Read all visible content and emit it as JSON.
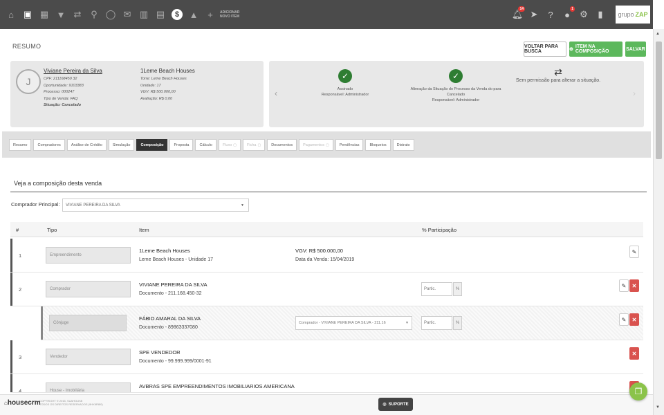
{
  "topbar": {
    "icons": [
      "home-icon",
      "calendar-icon",
      "grid-icon",
      "filter-icon",
      "handshake-icon",
      "map-pin-icon",
      "chat-icon",
      "mail-icon",
      "buildings-icon",
      "calculator-icon",
      "dollar-icon",
      "graduation-cap-icon",
      "plus-icon"
    ],
    "add_item_label": "Adicionar novo item",
    "notifications_badge": "14",
    "alerts_badge": "1",
    "brand_logo": "grupo",
    "brand_logo_accent": "ZAP"
  },
  "header": {
    "title": "RESUMO",
    "back_label": "VOLTAR PARA BUSCA",
    "add_composition_label": "ITEM NA COMPOSIÇÃO",
    "save_label": "SALVAR"
  },
  "person": {
    "avatar_initial": "J",
    "name": "Viviane Pereira da Silva",
    "cpf": "CPF: 211168450 32",
    "opportunity": "Oportunidade: 9103383",
    "process": "Processo: 000247",
    "sale_type": "Tipo de Venda: FAQ",
    "status": "Situação: Cancelado"
  },
  "venture": {
    "name": "1Leme Beach Houses",
    "tower": "Torre: Leme Beach Houses",
    "unit": "Unidade: 17",
    "vgv": "VGV: R$ 500.000,00",
    "evaluation": "Avaliação: R$ 0,00"
  },
  "status_steps": [
    {
      "title": "Assinado",
      "resp": "Responsável: Administrador"
    },
    {
      "title": "Alteração da Situação do Processo da Venda do para Cancelado",
      "resp": "Responsável: Administrador"
    },
    {
      "title": "Sem permissão para alterar a situação."
    }
  ],
  "tabs": [
    {
      "label": "Resumo"
    },
    {
      "label": "Compradores"
    },
    {
      "label": "Análise de Crédito"
    },
    {
      "label": "Simulação"
    },
    {
      "label": "Composição"
    },
    {
      "label": "Proposta"
    },
    {
      "label": "Cálculo"
    },
    {
      "label": "Fluxo"
    },
    {
      "label": "Ficha"
    },
    {
      "label": "Documentos"
    },
    {
      "label": "Pagamentos"
    },
    {
      "label": "Pendências"
    },
    {
      "label": "Bloqueios"
    },
    {
      "label": "Distrato"
    }
  ],
  "composition": {
    "title": "Veja a composição desta venda",
    "buyer_label": "Comprador Principal:",
    "buyer_value": "VIVIANE PEREIRA DA SILVA",
    "headers": {
      "num": "#",
      "tipo": "Tipo",
      "item": "Item",
      "part": "% Participação"
    },
    "rows": [
      {
        "num": "1",
        "tipo": "Empreendimento",
        "name": "1Leme Beach Houses",
        "desc": "Leme Beach Houses - Unidade 17",
        "vgv": "VGV: R$ 500.000,00",
        "date": "Data da Venda: 15/04/2019"
      },
      {
        "num": "2",
        "tipo": "Comprador",
        "name": "VIVIANE PEREIRA DA SILVA",
        "desc": "Documento - 211.168.450-32",
        "partic_placeholder": "Partic.",
        "pct": "%"
      },
      {
        "tipo": "Cônjuge",
        "name": "FÁBIO AMARAL DA SILVA",
        "desc": "Documento - 89863337080",
        "select": "Comprador - VIVIANE PEREIRA DA SILVA - 211.16",
        "partic_placeholder": "Partic.",
        "pct": "%"
      },
      {
        "num": "3",
        "tipo": "Vendedor",
        "name": "SPE VENDEDOR",
        "desc": "Documento - 99.999.999/0001-91"
      },
      {
        "num": "4",
        "tipo": "House - Imobiliária",
        "name": "AVBRAS SPE EMPREENDIMENTOS IMOBILIARIOS AMERICANA"
      }
    ]
  },
  "footer": {
    "brand": "housecrm",
    "copyright": "COPYRIGHT © 2015, SUAHOUSE",
    "rights": "TODOS OS DIREITOS RESERVADOS (9HX6R8I0)",
    "support_label": "SUPORTE"
  },
  "colors": {
    "topbar": "#4b4b4b",
    "accent_green": "#5cb85c",
    "delete_red": "#d9534f",
    "check_green": "#2e7d32"
  }
}
